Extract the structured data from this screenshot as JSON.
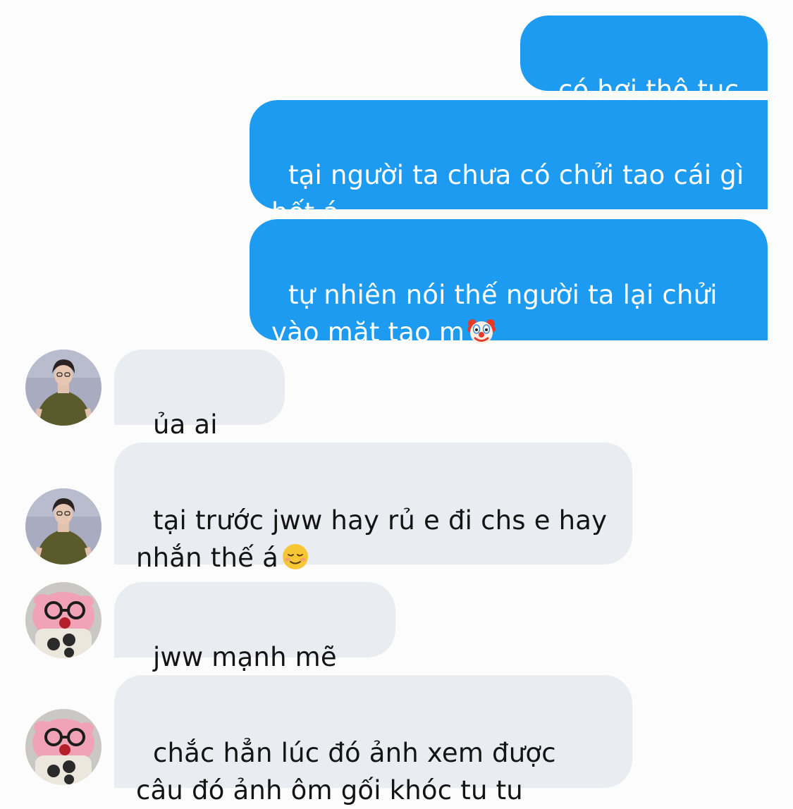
{
  "chat": {
    "messages": [
      {
        "id": "m1",
        "side": "outgoing",
        "text": "có hơi thô tục á"
      },
      {
        "id": "m2",
        "side": "outgoing",
        "text": "tại người ta chưa có chửi tao cái gì hết á"
      },
      {
        "id": "m3",
        "side": "outgoing",
        "text": "tự nhiên nói thế người ta lại chửi vào mặt tao m",
        "emoji": "clown-face"
      },
      {
        "id": "m4",
        "side": "incoming",
        "sender_avatar": "man-olive-tshirt-avatar",
        "text": "ủa ai biết"
      },
      {
        "id": "m5",
        "side": "incoming",
        "sender_avatar": "man-olive-tshirt-avatar",
        "text": "tại trước jww hay rủ e đi chs e hay nhắn thế á",
        "emoji": "smiling-face"
      },
      {
        "id": "m6",
        "side": "incoming",
        "sender_avatar": "pink-plush-glasses-avatar",
        "text": "jww mạnh mẽ thật"
      },
      {
        "id": "m7",
        "side": "incoming",
        "sender_avatar": "pink-plush-glasses-avatar",
        "text": "chắc hẳn lúc đó ảnh xem được câu đó ảnh ôm gối khóc tu tu"
      }
    ]
  },
  "colors": {
    "outgoing_bubble": "#1d9bf0",
    "incoming_bubble": "#e9ecf0",
    "background": "#fcfcfd"
  }
}
